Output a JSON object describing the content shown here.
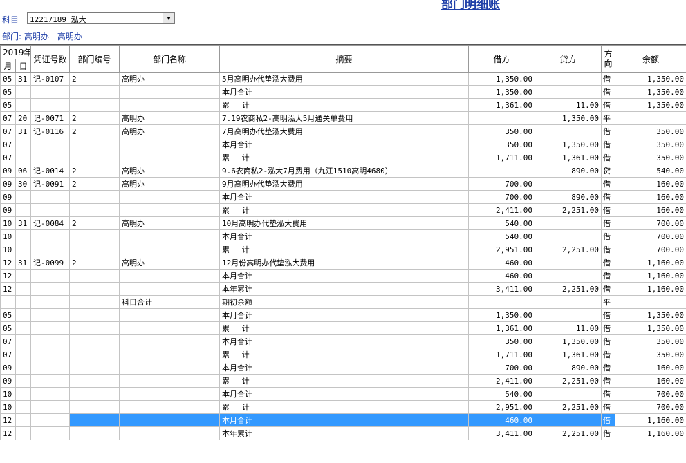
{
  "header": {
    "title": "部门明细账",
    "subject_label": "科目",
    "subject_value": "12217189 泓大",
    "dept_label": "部门: 高明办 - 高明办"
  },
  "columns": {
    "year": "2019年",
    "month": "月",
    "day": "日",
    "voucher": "凭证号数",
    "dept_code": "部门编号",
    "dept_name": "部门名称",
    "summary": "摘要",
    "debit": "借方",
    "credit": "贷方",
    "direction": "方向",
    "balance": "余额"
  },
  "rows": [
    {
      "m": "05",
      "d": "31",
      "v": "记-0107",
      "code": "2",
      "name": "高明办",
      "sum": "5月高明办代垫泓大费用",
      "dr": "1,350.00",
      "cr": "",
      "dir": "借",
      "bal": "1,350.00"
    },
    {
      "m": "05",
      "d": "",
      "v": "",
      "code": "",
      "name": "",
      "sum": "本月合计",
      "dr": "1,350.00",
      "cr": "",
      "dir": "借",
      "bal": "1,350.00"
    },
    {
      "m": "05",
      "d": "",
      "v": "",
      "code": "",
      "name": "",
      "sum": "累　 计",
      "dr": "1,361.00",
      "cr": "11.00",
      "dir": "借",
      "bal": "1,350.00"
    },
    {
      "m": "07",
      "d": "20",
      "v": "记-0071",
      "code": "2",
      "name": "高明办",
      "sum": "7.19农商私2-高明泓大5月通关单费用",
      "dr": "",
      "cr": "1,350.00",
      "dir": "平",
      "bal": ""
    },
    {
      "m": "07",
      "d": "31",
      "v": "记-0116",
      "code": "2",
      "name": "高明办",
      "sum": "7月高明办代垫泓大费用",
      "dr": "350.00",
      "cr": "",
      "dir": "借",
      "bal": "350.00"
    },
    {
      "m": "07",
      "d": "",
      "v": "",
      "code": "",
      "name": "",
      "sum": "本月合计",
      "dr": "350.00",
      "cr": "1,350.00",
      "dir": "借",
      "bal": "350.00"
    },
    {
      "m": "07",
      "d": "",
      "v": "",
      "code": "",
      "name": "",
      "sum": "累　 计",
      "dr": "1,711.00",
      "cr": "1,361.00",
      "dir": "借",
      "bal": "350.00"
    },
    {
      "m": "09",
      "d": "06",
      "v": "记-0014",
      "code": "2",
      "name": "高明办",
      "sum": "9.6农商私2-泓大7月费用（九江1510高明4680）",
      "dr": "",
      "cr": "890.00",
      "dir": "贷",
      "bal": "540.00"
    },
    {
      "m": "09",
      "d": "30",
      "v": "记-0091",
      "code": "2",
      "name": "高明办",
      "sum": "9月高明办代垫泓大费用",
      "dr": "700.00",
      "cr": "",
      "dir": "借",
      "bal": "160.00"
    },
    {
      "m": "09",
      "d": "",
      "v": "",
      "code": "",
      "name": "",
      "sum": "本月合计",
      "dr": "700.00",
      "cr": "890.00",
      "dir": "借",
      "bal": "160.00"
    },
    {
      "m": "09",
      "d": "",
      "v": "",
      "code": "",
      "name": "",
      "sum": "累　 计",
      "dr": "2,411.00",
      "cr": "2,251.00",
      "dir": "借",
      "bal": "160.00"
    },
    {
      "m": "10",
      "d": "31",
      "v": "记-0084",
      "code": "2",
      "name": "高明办",
      "sum": "10月高明办代垫泓大费用",
      "dr": "540.00",
      "cr": "",
      "dir": "借",
      "bal": "700.00"
    },
    {
      "m": "10",
      "d": "",
      "v": "",
      "code": "",
      "name": "",
      "sum": "本月合计",
      "dr": "540.00",
      "cr": "",
      "dir": "借",
      "bal": "700.00"
    },
    {
      "m": "10",
      "d": "",
      "v": "",
      "code": "",
      "name": "",
      "sum": "累　 计",
      "dr": "2,951.00",
      "cr": "2,251.00",
      "dir": "借",
      "bal": "700.00"
    },
    {
      "m": "12",
      "d": "31",
      "v": "记-0099",
      "code": "2",
      "name": "高明办",
      "sum": "12月份高明办代垫泓大费用",
      "dr": "460.00",
      "cr": "",
      "dir": "借",
      "bal": "1,160.00"
    },
    {
      "m": "12",
      "d": "",
      "v": "",
      "code": "",
      "name": "",
      "sum": "本月合计",
      "dr": "460.00",
      "cr": "",
      "dir": "借",
      "bal": "1,160.00"
    },
    {
      "m": "12",
      "d": "",
      "v": "",
      "code": "",
      "name": "",
      "sum": "本年累计",
      "dr": "3,411.00",
      "cr": "2,251.00",
      "dir": "借",
      "bal": "1,160.00"
    },
    {
      "m": "",
      "d": "",
      "v": "",
      "code": "",
      "name": "科目合计",
      "sum": "期初余额",
      "dr": "",
      "cr": "",
      "dir": "平",
      "bal": ""
    },
    {
      "m": "05",
      "d": "",
      "v": "",
      "code": "",
      "name": "",
      "sum": "本月合计",
      "dr": "1,350.00",
      "cr": "",
      "dir": "借",
      "bal": "1,350.00"
    },
    {
      "m": "05",
      "d": "",
      "v": "",
      "code": "",
      "name": "",
      "sum": "累　 计",
      "dr": "1,361.00",
      "cr": "11.00",
      "dir": "借",
      "bal": "1,350.00"
    },
    {
      "m": "07",
      "d": "",
      "v": "",
      "code": "",
      "name": "",
      "sum": "本月合计",
      "dr": "350.00",
      "cr": "1,350.00",
      "dir": "借",
      "bal": "350.00"
    },
    {
      "m": "07",
      "d": "",
      "v": "",
      "code": "",
      "name": "",
      "sum": "累　 计",
      "dr": "1,711.00",
      "cr": "1,361.00",
      "dir": "借",
      "bal": "350.00"
    },
    {
      "m": "09",
      "d": "",
      "v": "",
      "code": "",
      "name": "",
      "sum": "本月合计",
      "dr": "700.00",
      "cr": "890.00",
      "dir": "借",
      "bal": "160.00"
    },
    {
      "m": "09",
      "d": "",
      "v": "",
      "code": "",
      "name": "",
      "sum": "累　 计",
      "dr": "2,411.00",
      "cr": "2,251.00",
      "dir": "借",
      "bal": "160.00"
    },
    {
      "m": "10",
      "d": "",
      "v": "",
      "code": "",
      "name": "",
      "sum": "本月合计",
      "dr": "540.00",
      "cr": "",
      "dir": "借",
      "bal": "700.00"
    },
    {
      "m": "10",
      "d": "",
      "v": "",
      "code": "",
      "name": "",
      "sum": "累　 计",
      "dr": "2,951.00",
      "cr": "2,251.00",
      "dir": "借",
      "bal": "700.00"
    },
    {
      "m": "12",
      "d": "",
      "v": "",
      "code": "",
      "name": "",
      "sum": "本月合计",
      "dr": "460.00",
      "cr": "",
      "dir": "借",
      "bal": "1,160.00",
      "selected": true
    },
    {
      "m": "12",
      "d": "",
      "v": "",
      "code": "",
      "name": "",
      "sum": "本年累计",
      "dr": "3,411.00",
      "cr": "2,251.00",
      "dir": "借",
      "bal": "1,160.00"
    }
  ]
}
